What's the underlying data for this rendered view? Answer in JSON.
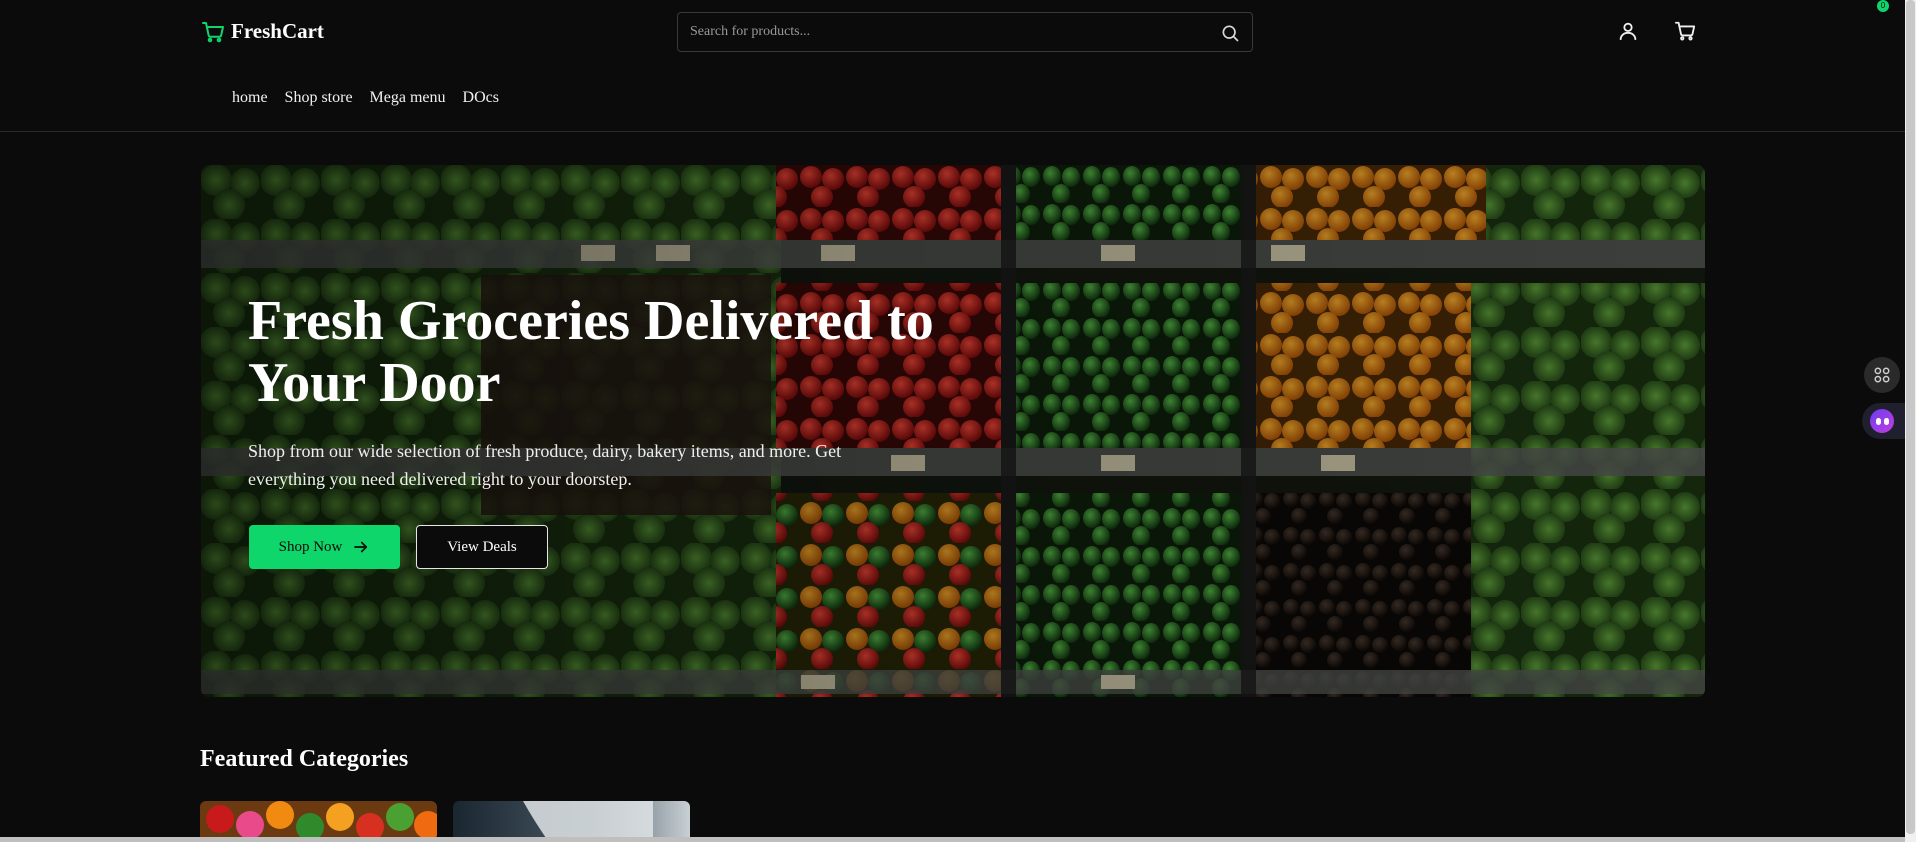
{
  "header": {
    "logo_text": "FreshCart",
    "search_placeholder": "Search for products...",
    "nav": [
      "home",
      "Shop store",
      "Mega menu",
      "DOcs"
    ]
  },
  "hero": {
    "title": "Fresh Groceries Delivered to Your Door",
    "subtitle": "Shop from our wide selection of fresh produce, dairy, bakery items, and more. Get everything you need delivered right to your doorstep.",
    "primary_button": "Shop Now",
    "secondary_button": "View Deals"
  },
  "featured": {
    "title": "Featured Categories"
  },
  "widgets": {
    "badge_count": "0"
  },
  "colors": {
    "accent": "#0fd66b",
    "background": "#0b0b0b"
  },
  "icons": [
    "cart-icon",
    "search-icon",
    "user-icon",
    "arrow-right-icon",
    "grid-icon",
    "bot-icon"
  ]
}
